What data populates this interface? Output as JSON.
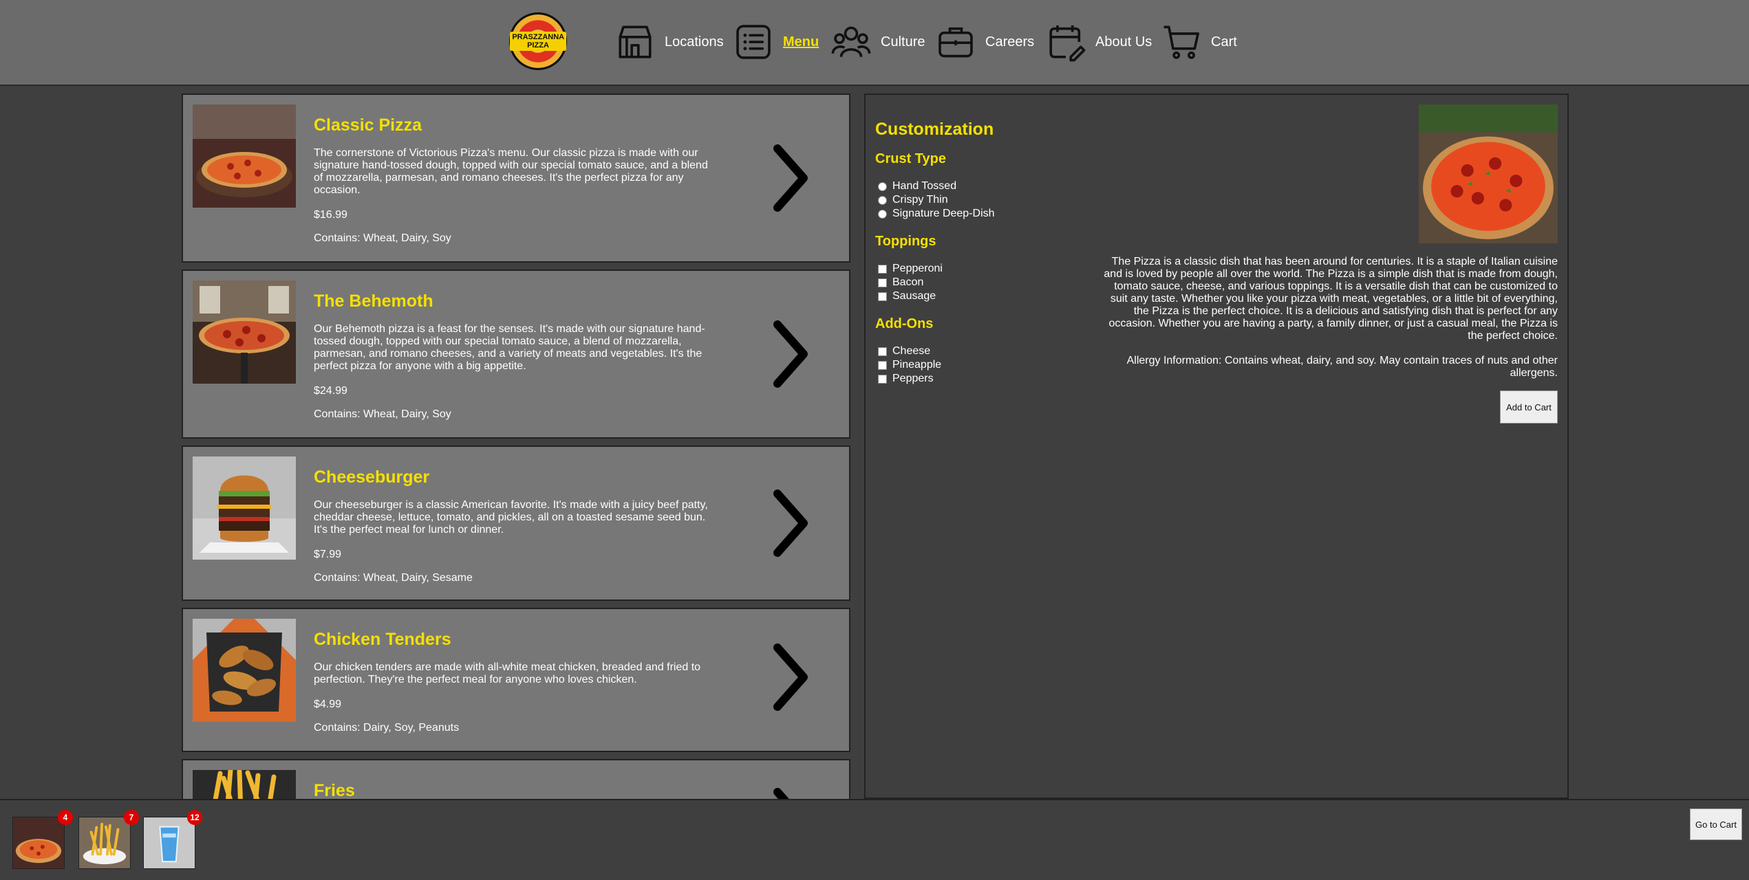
{
  "nav": {
    "logo_text": "PRASZZANNA PIZZA",
    "items": [
      {
        "label": "Locations",
        "icon": "storefront-icon"
      },
      {
        "label": "Menu",
        "icon": "list-icon",
        "active": true
      },
      {
        "label": "Culture",
        "icon": "people-icon"
      },
      {
        "label": "Careers",
        "icon": "briefcase-icon"
      },
      {
        "label": "About Us",
        "icon": "calendar-edit-icon"
      },
      {
        "label": "Cart",
        "icon": "cart-icon"
      }
    ]
  },
  "menu": {
    "items": [
      {
        "title": "Classic Pizza",
        "description": "The cornerstone of Victorious Pizza's menu. Our classic pizza is made with our signature hand-tossed dough, topped with our special tomato sauce, and a blend of mozzarella, parmesan, and romano cheeses. It's the perfect pizza for any occasion.",
        "price": "$16.99",
        "allergens": "Contains: Wheat, Dairy, Soy"
      },
      {
        "title": "The Behemoth",
        "description": "Our Behemoth pizza is a feast for the senses. It's made with our signature hand-tossed dough, topped with our special tomato sauce, a blend of mozzarella, parmesan, and romano cheeses, and a variety of meats and vegetables. It's the perfect pizza for anyone with a big appetite.",
        "price": "$24.99",
        "allergens": "Contains: Wheat, Dairy, Soy"
      },
      {
        "title": "Cheeseburger",
        "description": "Our cheeseburger is a classic American favorite. It's made with a juicy beef patty, cheddar cheese, lettuce, tomato, and pickles, all on a toasted sesame seed bun. It's the perfect meal for lunch or dinner.",
        "price": "$7.99",
        "allergens": "Contains: Wheat, Dairy, Sesame"
      },
      {
        "title": "Chicken Tenders",
        "description": "Our chicken tenders are made with all-white meat chicken, breaded and fried to perfection. They're the perfect meal for anyone who loves chicken.",
        "price": "$4.99",
        "allergens": "Contains: Dairy, Soy, Peanuts"
      },
      {
        "title": "Fries"
      }
    ]
  },
  "customization": {
    "title": "Customization",
    "crust": {
      "title": "Crust Type",
      "options": [
        "Hand Tossed",
        "Crispy Thin",
        "Signature Deep-Dish"
      ]
    },
    "toppings": {
      "title": "Toppings",
      "options": [
        "Pepperoni",
        "Bacon",
        "Sausage"
      ]
    },
    "addons": {
      "title": "Add-Ons",
      "options": [
        "Cheese",
        "Pineapple",
        "Peppers"
      ]
    },
    "description": "The Pizza is a classic dish that has been around for centuries. It is a staple of Italian cuisine and is loved by people all over the world. The Pizza is a simple dish that is made from dough, tomato sauce, cheese, and various toppings. It is a versatile dish that can be customized to suit any taste. Whether you like your pizza with meat, vegetables, or a little bit of everything, the Pizza is the perfect choice. It is a delicious and satisfying dish that is perfect for any occasion. Whether you are having a party, a family dinner, or just a casual meal, the Pizza is the perfect choice.",
    "allergy": "Allergy Information: Contains wheat, dairy, and soy. May contain traces of nuts and other allergens.",
    "add_label": "Add to Cart"
  },
  "cart": {
    "items": [
      {
        "name": "pizza-thumb",
        "count": "4"
      },
      {
        "name": "fries-thumb",
        "count": "7"
      },
      {
        "name": "drink-thumb",
        "count": "12"
      }
    ],
    "goto_label": "Go to Cart"
  },
  "colors": {
    "accent": "#f5e000",
    "nav_bg": "#6b6b6b",
    "page_bg": "#3f3f3f",
    "card_bg": "#777777",
    "badge": "#e00000"
  }
}
